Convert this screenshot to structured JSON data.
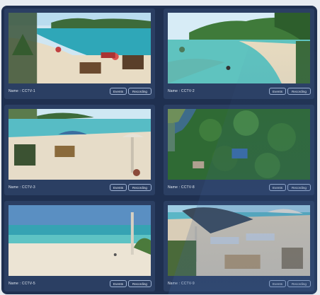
{
  "cameras": [
    {
      "name": "Name : CCTV-1",
      "events_label": "Events",
      "recording_label": "Recording"
    },
    {
      "name": "Name : CCTV-2",
      "events_label": "Events",
      "recording_label": "Recording"
    },
    {
      "name": "Name : CCTV-3",
      "events_label": "Events",
      "recording_label": "Recording"
    },
    {
      "name": "Name : CCTV-8",
      "events_label": "Events",
      "recording_label": "Recording"
    },
    {
      "name": "Name : CCTV-5",
      "events_label": "Events",
      "recording_label": "Recording"
    },
    {
      "name": "Name : CCTV-9",
      "events_label": "Events",
      "recording_label": "Recording"
    }
  ],
  "colors": {
    "panel_bg": "#1f3050",
    "card_bg": "#2b3f63",
    "button_border": "#9fb3d4",
    "text": "#e6ecf5"
  }
}
